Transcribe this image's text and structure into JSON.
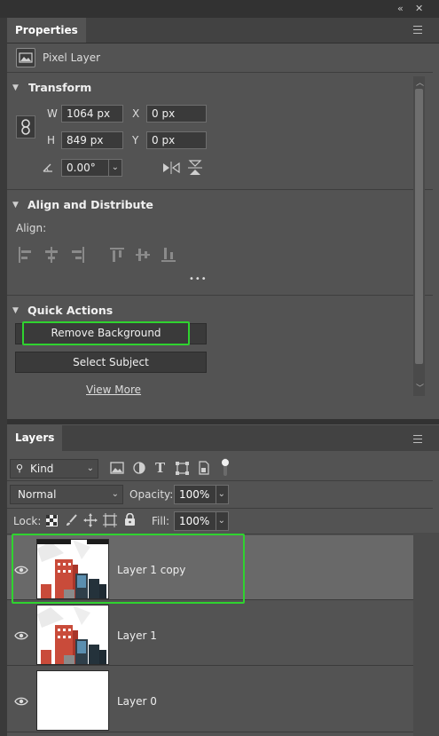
{
  "window": {
    "collapse_glyph": "‹‹",
    "close_glyph": "✕"
  },
  "properties": {
    "tab_label": "Properties",
    "layer_type": "Pixel Layer",
    "transform": {
      "title": "Transform",
      "w_label": "W",
      "w_value": "1064 px",
      "h_label": "H",
      "h_value": "849 px",
      "x_label": "X",
      "x_value": "0 px",
      "y_label": "Y",
      "y_value": "0 px",
      "angle_value": "0.00°"
    },
    "align": {
      "title": "Align and Distribute",
      "align_label": "Align:",
      "more": "•••"
    },
    "quick_actions": {
      "title": "Quick Actions",
      "remove_background": "Remove Background",
      "select_subject": "Select Subject",
      "view_more": "View More"
    }
  },
  "layers": {
    "tab_label": "Layers",
    "filter_kind": "Kind",
    "blend_mode": "Normal",
    "opacity_label": "Opacity:",
    "opacity_value": "100%",
    "lock_label": "Lock:",
    "fill_label": "Fill:",
    "fill_value": "100%",
    "items": [
      {
        "name": "Layer 1 copy",
        "selected": true,
        "visible": true
      },
      {
        "name": "Layer 1",
        "selected": false,
        "visible": true
      },
      {
        "name": "Layer 0",
        "selected": false,
        "visible": true
      }
    ]
  },
  "colors": {
    "highlight": "#2fd32f",
    "panel_bg": "#535353",
    "selected_row": "#696969"
  }
}
